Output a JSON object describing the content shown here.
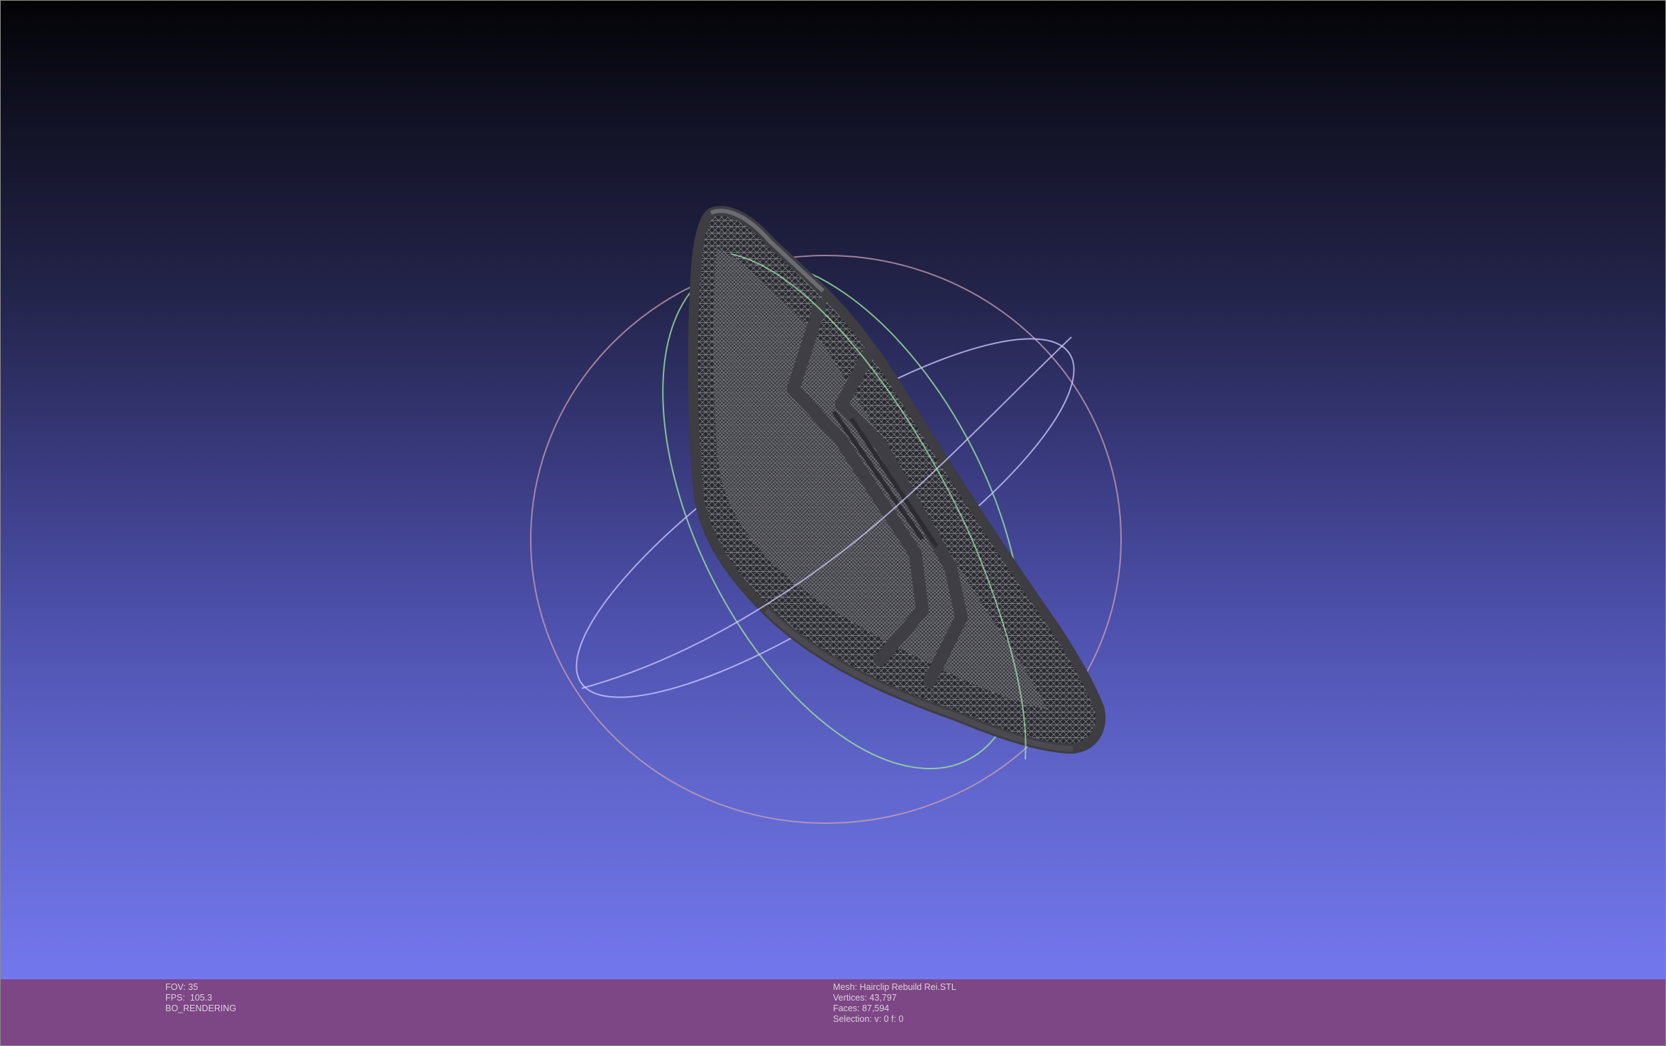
{
  "viewer": {
    "mesh_filename": "Hairclip Rebuild Rei.STL"
  },
  "status": {
    "fov": "FOV: 35",
    "fps": "FPS:  105.3",
    "rendering": "BO_RENDERING",
    "mesh": "Mesh: Hairclip Rebuild Rei.STL",
    "vertices": "Vertices: 43,797",
    "faces": "Faces: 87,594",
    "selection": "Selection: v: 0 f: 0"
  },
  "colors": {
    "status_bar": "#7d4685",
    "gradient_top": "#030306",
    "gradient_bottom": "#7377ee",
    "trackball_x": "#d8c0ff",
    "trackball_y": "#a8f0a8",
    "trackball_z": "#f0b0b0",
    "mesh_wire": "#555555"
  }
}
